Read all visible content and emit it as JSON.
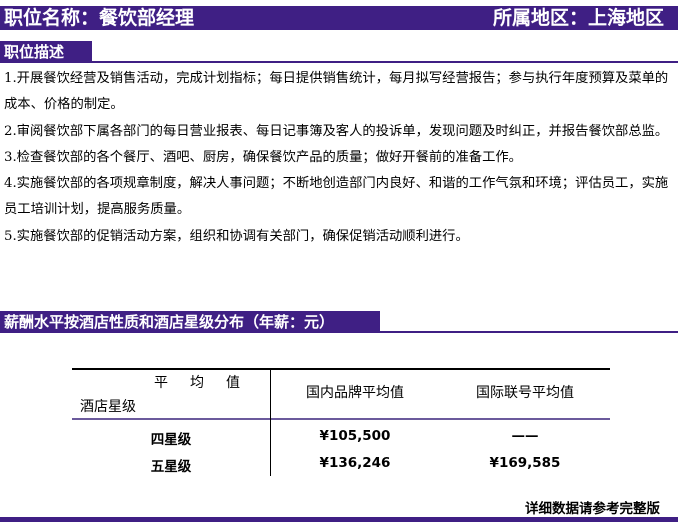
{
  "header": {
    "job_title": "职位名称：餐饮部经理",
    "region": "所属地区：上海地区"
  },
  "description": {
    "heading": "职位描述",
    "items": [
      "1.开展餐饮经营及销售活动，完成计划指标；每日提供销售统计，每月拟写经营报告；参与执行年度预算及菜单的成本、价格的制定。",
      "2.审阅餐饮部下属各部门的每日营业报表、每日记事簿及客人的投诉单，发现问题及时纠正，并报告餐饮部总监。",
      "3.检查餐饮部的各个餐厅、酒吧、厨房，确保餐饮产品的质量；做好开餐前的准备工作。",
      "4.实施餐饮部的各项规章制度，解决人事问题；不断地创造部门内良好、和谐的工作气氛和环境；评估员工，实施员工培训计划，提高服务质量。",
      "5.实施餐饮部的促销活动方案，组织和协调有关部门，确保促销活动顺利进行。"
    ]
  },
  "salary": {
    "heading": "薪酬水平按酒店性质和酒店星级分布（年薪：元）",
    "table": {
      "corner_top": "平均值",
      "corner_bottom": "酒店星级",
      "col_domestic": "国内品牌平均值",
      "col_international": "国际联号平均值",
      "rows": [
        {
          "level": "四星级",
          "domestic": "¥105,500",
          "international": "——"
        },
        {
          "level": "五星级",
          "domestic": "¥136,246",
          "international": "¥169,585"
        }
      ]
    }
  },
  "footer": {
    "note": "详细数据请参考完整版"
  },
  "colors": {
    "accent": "#3f1f84",
    "table_line": "#6b5a9c"
  }
}
